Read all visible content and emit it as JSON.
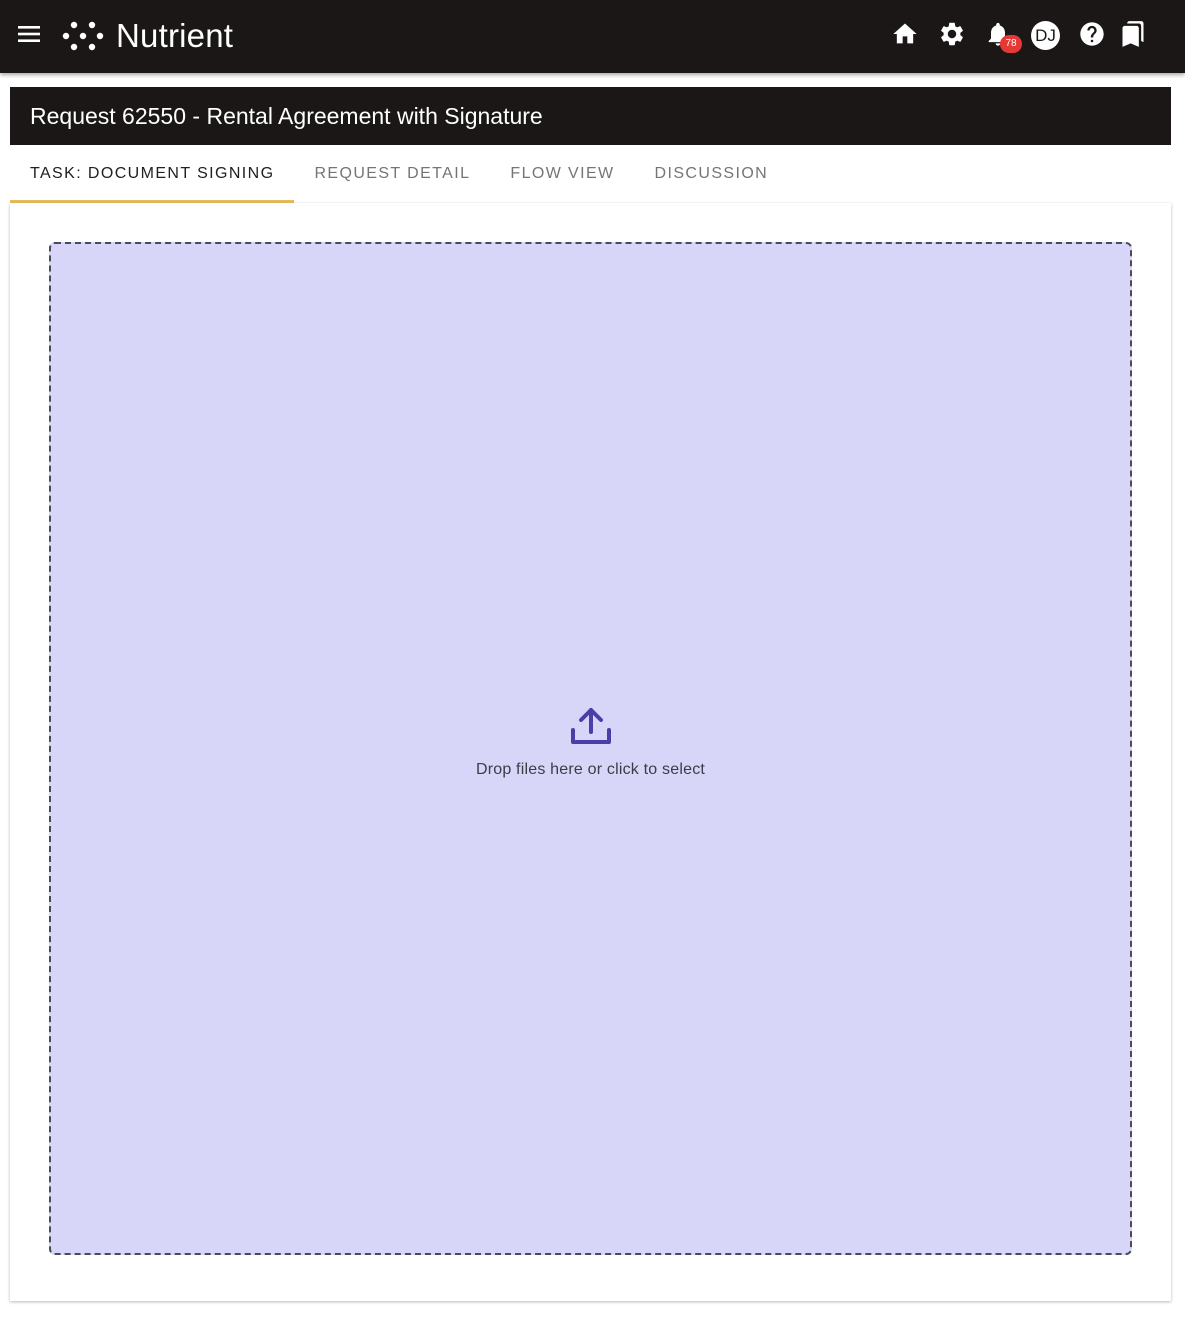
{
  "header": {
    "brand_name": "Nutrient",
    "notification_count": "78",
    "user_initials": "DJ",
    "icons": [
      "menu-icon",
      "nutrient-logo-icon",
      "home-icon",
      "gear-icon",
      "bell-icon",
      "help-icon",
      "bookmark-icon"
    ]
  },
  "request": {
    "title": "Request 62550 - Rental Agreement with Signature"
  },
  "tabs": [
    {
      "label": "TASK: DOCUMENT SIGNING",
      "active": true
    },
    {
      "label": "REQUEST DETAIL",
      "active": false
    },
    {
      "label": "FLOW VIEW",
      "active": false
    },
    {
      "label": "DISCUSSION",
      "active": false
    }
  ],
  "dropzone": {
    "text": "Drop files here or click to select",
    "icon": "upload-icon"
  },
  "colors": {
    "topbar": "#1b1717",
    "active_tab_indicator": "#e6bd5c",
    "dropzone_background": "#d8d6f8",
    "upload_icon": "#4a3ea8",
    "badge": "#e53935"
  }
}
